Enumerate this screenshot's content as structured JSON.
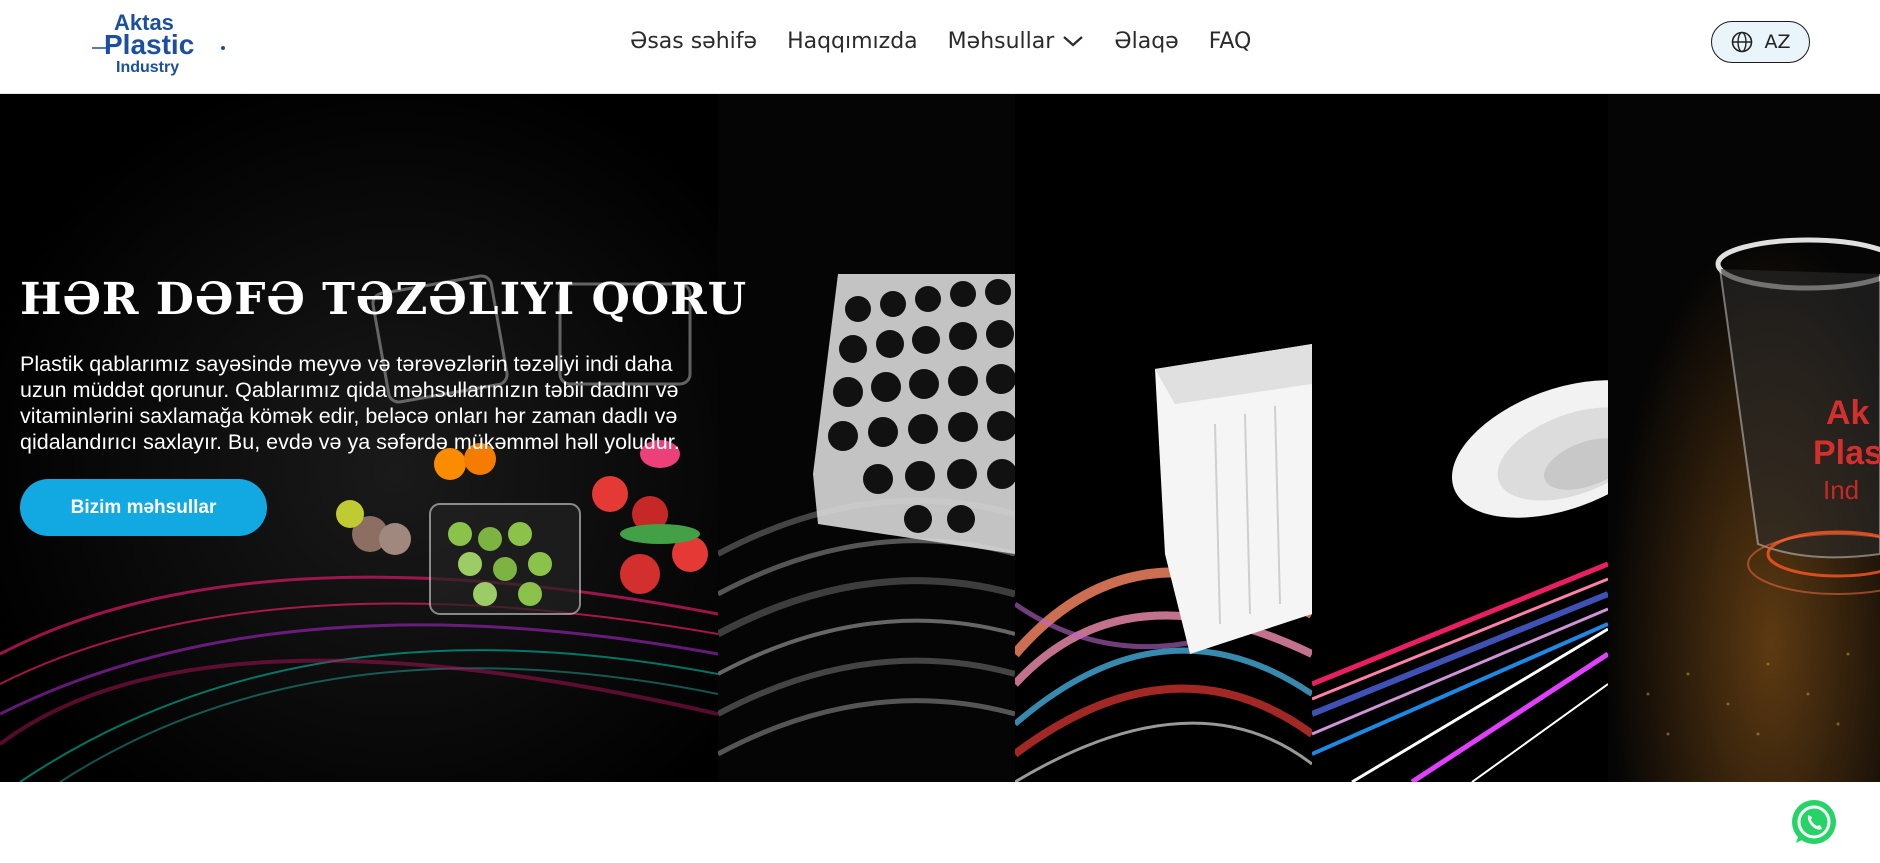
{
  "brand": {
    "logo_line1": "Aktas",
    "logo_line2": "Plastic",
    "logo_line3": "Industry",
    "logo_color": "#1d4fa0"
  },
  "nav": {
    "items": [
      {
        "label": "Əsas səhifə"
      },
      {
        "label": "Haqqımızda"
      },
      {
        "label": "Məhsullar",
        "has_dropdown": true
      },
      {
        "label": "Əlaqə"
      },
      {
        "label": "FAQ"
      }
    ]
  },
  "language": {
    "selected": "AZ",
    "icon": "globe-icon"
  },
  "hero": {
    "title": "HƏR DƏFƏ TƏZƏLIYI QORU",
    "description": "Plastik qablarımız sayəsində meyvə və tərəvəzlərin təzəliyi indi daha uzun müddət qorunur. Qablarımız qida məhsullarınızın təbii dadını və vitaminlərini saxlamağa kömək edir, beləcə onları hər zaman dadlı və qidalandırıcı saxlayır. Bu, evdə və ya səfərdə mükəmməl həll yoludur.",
    "button_label": "Bizim məhsullar",
    "accent_color": "#12a8e2"
  },
  "floating": {
    "whatsapp_icon": "whatsapp-icon",
    "whatsapp_color": "#25d366"
  }
}
